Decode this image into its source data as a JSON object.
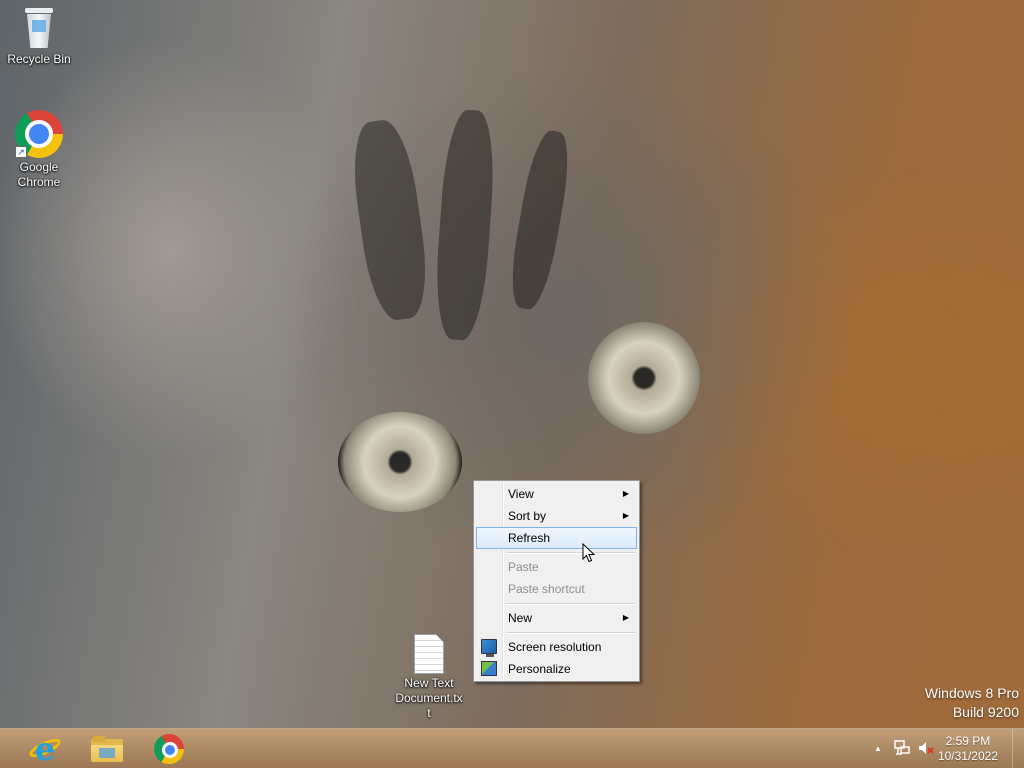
{
  "desktop": {
    "icons": [
      {
        "label": "Recycle Bin",
        "icon": "recycle-bin-icon"
      },
      {
        "label": "Google Chrome",
        "icon": "chrome-icon"
      },
      {
        "label": "New Text Document.txt",
        "icon": "text-file-icon"
      }
    ]
  },
  "context_menu": {
    "items": [
      {
        "label": "View",
        "submenu": true
      },
      {
        "label": "Sort by",
        "submenu": true
      },
      {
        "label": "Refresh",
        "highlighted": true
      },
      {
        "label": "Paste",
        "disabled": true
      },
      {
        "label": "Paste shortcut",
        "disabled": true
      },
      {
        "label": "New",
        "submenu": true
      },
      {
        "label": "Screen resolution",
        "icon": "monitor-icon"
      },
      {
        "label": "Personalize",
        "icon": "personalize-icon"
      }
    ],
    "submenu_arrow": "▶"
  },
  "watermark": {
    "line1": "Windows 8 Pro",
    "line2": "Build 9200"
  },
  "taskbar": {
    "pinned": [
      {
        "name": "Internet Explorer",
        "icon": "internet-explorer-icon"
      },
      {
        "name": "File Explorer",
        "icon": "file-explorer-icon"
      },
      {
        "name": "Google Chrome",
        "icon": "chrome-icon"
      }
    ],
    "tray": {
      "show_hidden": "▲",
      "icons": [
        "network-icon",
        "volume-muted-icon"
      ]
    },
    "clock": {
      "time": "2:59 PM",
      "date": "10/31/2022"
    }
  },
  "colors": {
    "menu_bg": "#f0f0f0",
    "menu_highlight": "#dcebfc",
    "menu_highlight_border": "#7eb4ea",
    "taskbar": "#a67c52"
  }
}
